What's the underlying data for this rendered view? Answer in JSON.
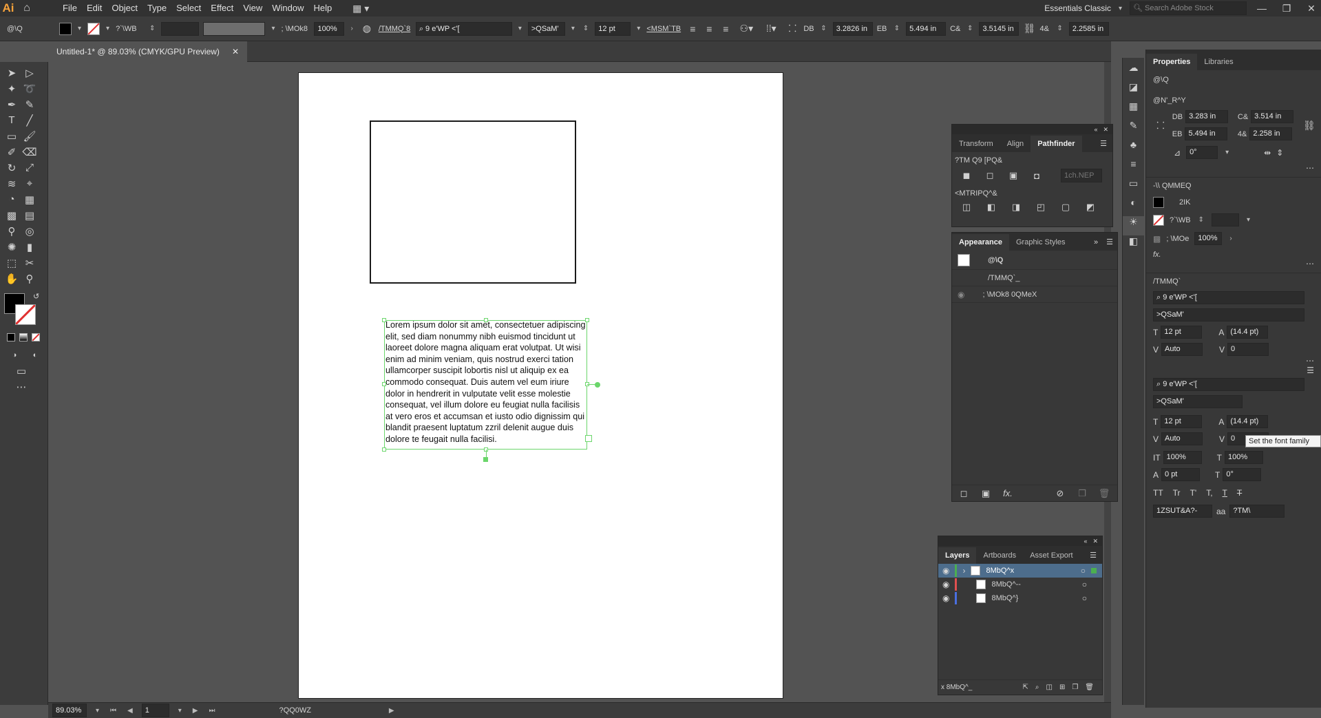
{
  "app": {
    "logo": "Ai",
    "home_icon": "home-icon",
    "workspace": "Essentials Classic",
    "search_placeholder": "Search Adobe Stock"
  },
  "menu": [
    "File",
    "Edit",
    "Object",
    "Type",
    "Select",
    "Effect",
    "View",
    "Window",
    "Help"
  ],
  "control_bar": {
    "selection_label": "@\\Q",
    "stroke_label": "?`\\WB",
    "opacity_label": "; \\MOk8",
    "opacity_value": "100%",
    "char_label": "/TMMQ`8",
    "font_family": "9 e'WP <'[",
    "font_style": ">QSaM'",
    "font_size": "12 pt",
    "para_label": "<MSM`TB",
    "x_label": "DB",
    "x_value": "3.2826 in",
    "y_label": "EB",
    "y_value": "5.494 in",
    "w_label": "C&",
    "w_value": "3.5145 in",
    "h_label": "4&",
    "h_value": "2.2585 in"
  },
  "document": {
    "tab_title": "Untitled-1* @ 89.03% (CMYK/GPU Preview)"
  },
  "artboard": {
    "lorem": "Lorem ipsum dolor sit amet, consectetuer adipiscing elit, sed diam nonummy nibh euismod tincidunt ut laoreet dolore magna aliquam erat volutpat. Ut wisi enim ad minim veniam, quis nostrud exerci tation ullamcorper suscipit lobortis nisl ut aliquip ex ea commodo consequat. Duis autem vel eum iriure dolor in hendrerit in vulputate velit esse molestie consequat, vel illum dolore eu feugiat nulla facilisis at vero eros et accumsan et iusto odio dignissim qui blandit praesent luptatum zzril delenit augue duis dolore te feugait nulla facilisi."
  },
  "pathfinder": {
    "tabs": [
      "Transform",
      "Align",
      "Pathfinder"
    ],
    "shape_modes_label": "?TM Q9 [PQ&",
    "expand_label": "1ch.NEP",
    "pathfinders_label": "<MTRIPQ^&"
  },
  "appearance": {
    "tabs": [
      "Appearance",
      "Graphic Styles"
    ],
    "row_type": "@\\Q",
    "row_char": "/TMMQ`_",
    "row_opacity": "; \\MOk8 0QMeX",
    "fx": "fx."
  },
  "layers": {
    "tabs": [
      "Layers",
      "Artboards",
      "Asset Export"
    ],
    "items": [
      {
        "name": "8MbQ^x",
        "color": "#4caf50"
      },
      {
        "name": "8MbQ^--",
        "color": "#e05050"
      },
      {
        "name": "8MbQ^}",
        "color": "#4a6fe0"
      }
    ],
    "count_label": "x 8MbQ^_"
  },
  "properties": {
    "tabs": [
      "Properties",
      "Libraries"
    ],
    "section_selection": "@\\Q",
    "section_transform": "@N'_R^Y",
    "x_label": "DB",
    "x_value": "3.283 in",
    "y_label": "EB",
    "y_value": "5.494 in",
    "w_label": "C&",
    "w_value": "3.514 in",
    "h_label": "4&",
    "h_value": "2.258 in",
    "angle_value": "0°",
    "section_appearance": "-\\\\ QMMEQ",
    "fill_label": "2IK",
    "stroke_label": "?`\\WB",
    "opacity_label": "; \\MOe",
    "opacity_value": "100%",
    "fx": "fx.",
    "section_character": "/TMMQ`",
    "font_family": "9 e'WP <'[",
    "font_style": ">QSaM'",
    "font_size": "12 pt",
    "leading": "(14.4 pt)",
    "kerning": "Auto",
    "tracking": "0",
    "font_family_2": "9 e'WP <'[",
    "font_style_2": ">QSaM'",
    "font_size_2": "12 pt",
    "leading_2": "(14.4 pt)",
    "kerning_2": "Auto",
    "tracking_2": "0",
    "vscale": "100%",
    "hscale": "100%",
    "baseline": "0 pt",
    "rotation": "0°",
    "caps_1": "TT",
    "caps_2": "Tr",
    "caps_3": "T'",
    "caps_4": "T,",
    "caps_5": "T",
    "caps_6": "T",
    "lang": "1ZSUT&A?-",
    "aa": "?TM\\"
  },
  "tooltip": "Set the font family",
  "status": {
    "zoom": "89.03%",
    "artboard_num": "1",
    "tool_name": "?QQ0WZ"
  }
}
